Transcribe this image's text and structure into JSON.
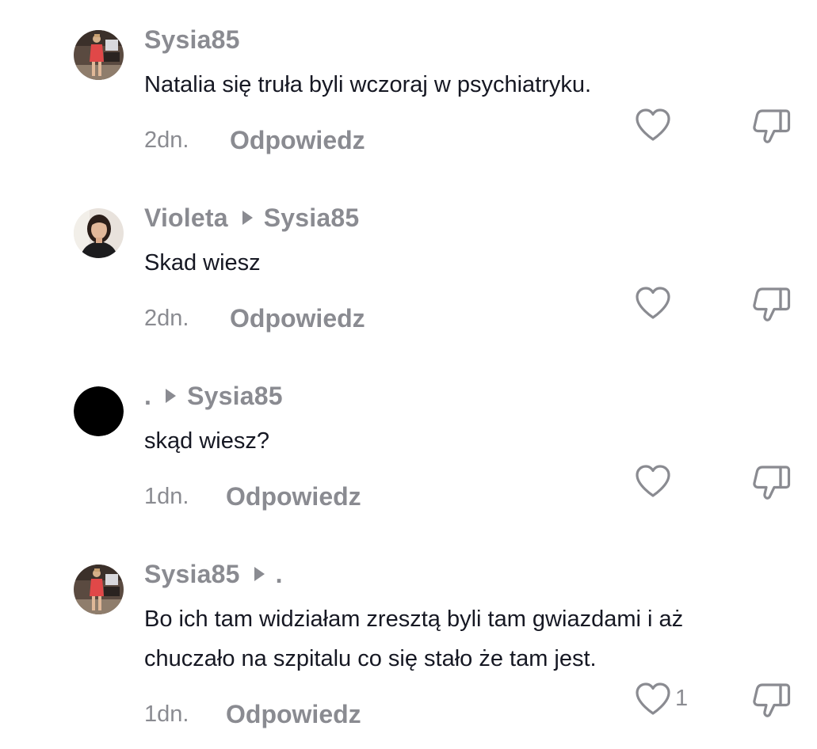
{
  "reply_label": "Odpowiedz",
  "comments": [
    {
      "username": "Sysia85",
      "reply_to": "",
      "text": "Natalia się truła byli wczoraj w psychiatryku.",
      "time": "2dn.",
      "likes": "",
      "avatar": "photo-red-dress"
    },
    {
      "username": "Violeta",
      "reply_to": "Sysia85",
      "text": "Skad wiesz",
      "time": "2dn.",
      "likes": "",
      "avatar": "photo-portrait"
    },
    {
      "username": ".",
      "reply_to": "Sysia85",
      "text": "skąd wiesz?",
      "time": "1dn.",
      "likes": "",
      "avatar": "black-circle"
    },
    {
      "username": "Sysia85",
      "reply_to": ".",
      "text": "Bo ich tam widziałam zresztą byli tam gwiazdami i aż chuczało na szpitalu co się stało że tam jest.",
      "time": "1dn.",
      "likes": "1",
      "avatar": "photo-red-dress"
    }
  ],
  "icons": {
    "like": "heart-outline-icon",
    "dislike": "thumbs-down-outline-icon",
    "reply_arrow": "triangle-right-icon"
  },
  "colors": {
    "muted": "#8a8b91",
    "text": "#161823",
    "icon": "#8a8b91"
  }
}
